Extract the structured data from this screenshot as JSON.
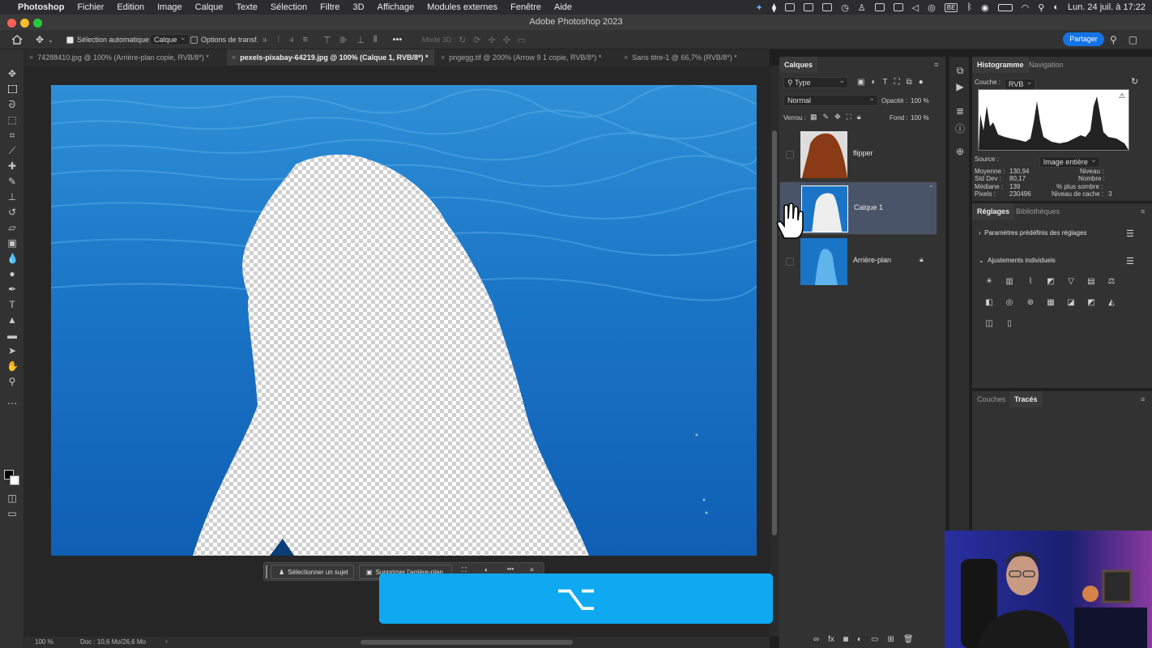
{
  "menubar": {
    "app": "Photoshop",
    "items": [
      "Fichier",
      "Edition",
      "Image",
      "Calque",
      "Texte",
      "Sélection",
      "Filtre",
      "3D",
      "Affichage",
      "Modules externes",
      "Fenêtre",
      "Aide"
    ],
    "status": {
      "input_source": "BE",
      "clock": "Lun. 24 juil. à 17:22"
    }
  },
  "window": {
    "title": "Adobe Photoshop 2023"
  },
  "options": {
    "auto_select_label": "Sélection automatique :",
    "auto_select_value": "Calque",
    "transform_label": "Options de transf.",
    "mode3d_label": "Mode 3D :",
    "share_label": "Partager"
  },
  "tabs": [
    {
      "label": "74288410.jpg @ 100% (Arrière-plan copie, RVB/8*) *",
      "active": false
    },
    {
      "label": "pexels-pixabay-64219.jpg @ 100% (Calque 1, RVB/8*) *",
      "active": true
    },
    {
      "label": "pngegg.tif @ 200% (Arrow 9 1 copie, RVB/8*) *",
      "active": false
    },
    {
      "label": "Sans titre-1 @ 66,7% (RVB/8*) *",
      "active": false
    }
  ],
  "contextual_bar": {
    "select_subject": "Sélectionner un sujet",
    "remove_bg": "Supprimer l'arrière-plan"
  },
  "key_overlay": {
    "key": "⌥"
  },
  "status": {
    "zoom": "100 %",
    "doc": "Doc : 10,6 Mo/26,6 Mo"
  },
  "layers_panel": {
    "title": "Calques",
    "filter": "Type",
    "blend_mode": "Normal",
    "opacity_label": "Opacité :",
    "opacity": "100 %",
    "lock_label": "Verrou :",
    "fill_label": "Fond :",
    "fill": "100 %",
    "layers": [
      {
        "name": "flipper",
        "selected": false
      },
      {
        "name": "Calque 1",
        "selected": true
      },
      {
        "name": "Arrière-plan",
        "selected": false,
        "locked": true
      }
    ]
  },
  "histogram_panel": {
    "tabs": [
      "Histogramme",
      "Navigation"
    ],
    "channel_label": "Couche :",
    "channel": "RVB",
    "source_label": "Source :",
    "source": "Image entière",
    "stats": {
      "moyenne_label": "Moyenne :",
      "moyenne": "130,94",
      "stddev_label": "Std Dev :",
      "stddev": "80,17",
      "mediane_label": "Médiane :",
      "mediane": "139",
      "pixels_label": "Pixels :",
      "pixels": "230496",
      "niveau_label": "Niveau :",
      "nombre_label": "Nombre :",
      "plus_sombre_label": "% plus sombre :",
      "cache_label": "Niveau de cache :",
      "cache": "3"
    }
  },
  "adjustments_panel": {
    "tabs": [
      "Réglages",
      "Bibliothèques"
    ],
    "presets": "Paramètres prédéfinis des réglages",
    "individual": "Ajustements individuels"
  },
  "paths_panel": {
    "tabs": [
      "Couches",
      "Tracés"
    ]
  },
  "colors": {
    "accent": "#1473e6",
    "overlay": "#0ea9f1",
    "selected_layer": "#4a5468",
    "flipper": "#8a3a14"
  }
}
